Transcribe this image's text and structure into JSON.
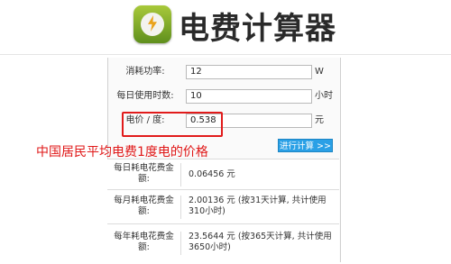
{
  "header": {
    "title": "电费计算器",
    "logo_icon": "lightning-bolt-icon"
  },
  "form": {
    "power": {
      "label": "消耗功率:",
      "value": "12",
      "unit": "W"
    },
    "hours": {
      "label": "每日使用时数:",
      "value": "10",
      "unit": "小时"
    },
    "price": {
      "label": "电价 / 度:",
      "value": "0.538",
      "unit": "元"
    }
  },
  "annotation": {
    "text": "中国居民平均电费1度电的价格",
    "color": "#e01818"
  },
  "calculate_button": {
    "label": "进行计算 >>",
    "color": "#2aa0e6"
  },
  "results": [
    {
      "label": "每日耗电花费金额:",
      "value": "0.06456 元"
    },
    {
      "label": "每月耗电花费金额:",
      "value": "2.00136 元 (按31天计算, 共计使用310小时)"
    },
    {
      "label": "每年耗电花费金额:",
      "value": "23.5644 元 (按365天计算, 共计使用3650小时)"
    }
  ]
}
